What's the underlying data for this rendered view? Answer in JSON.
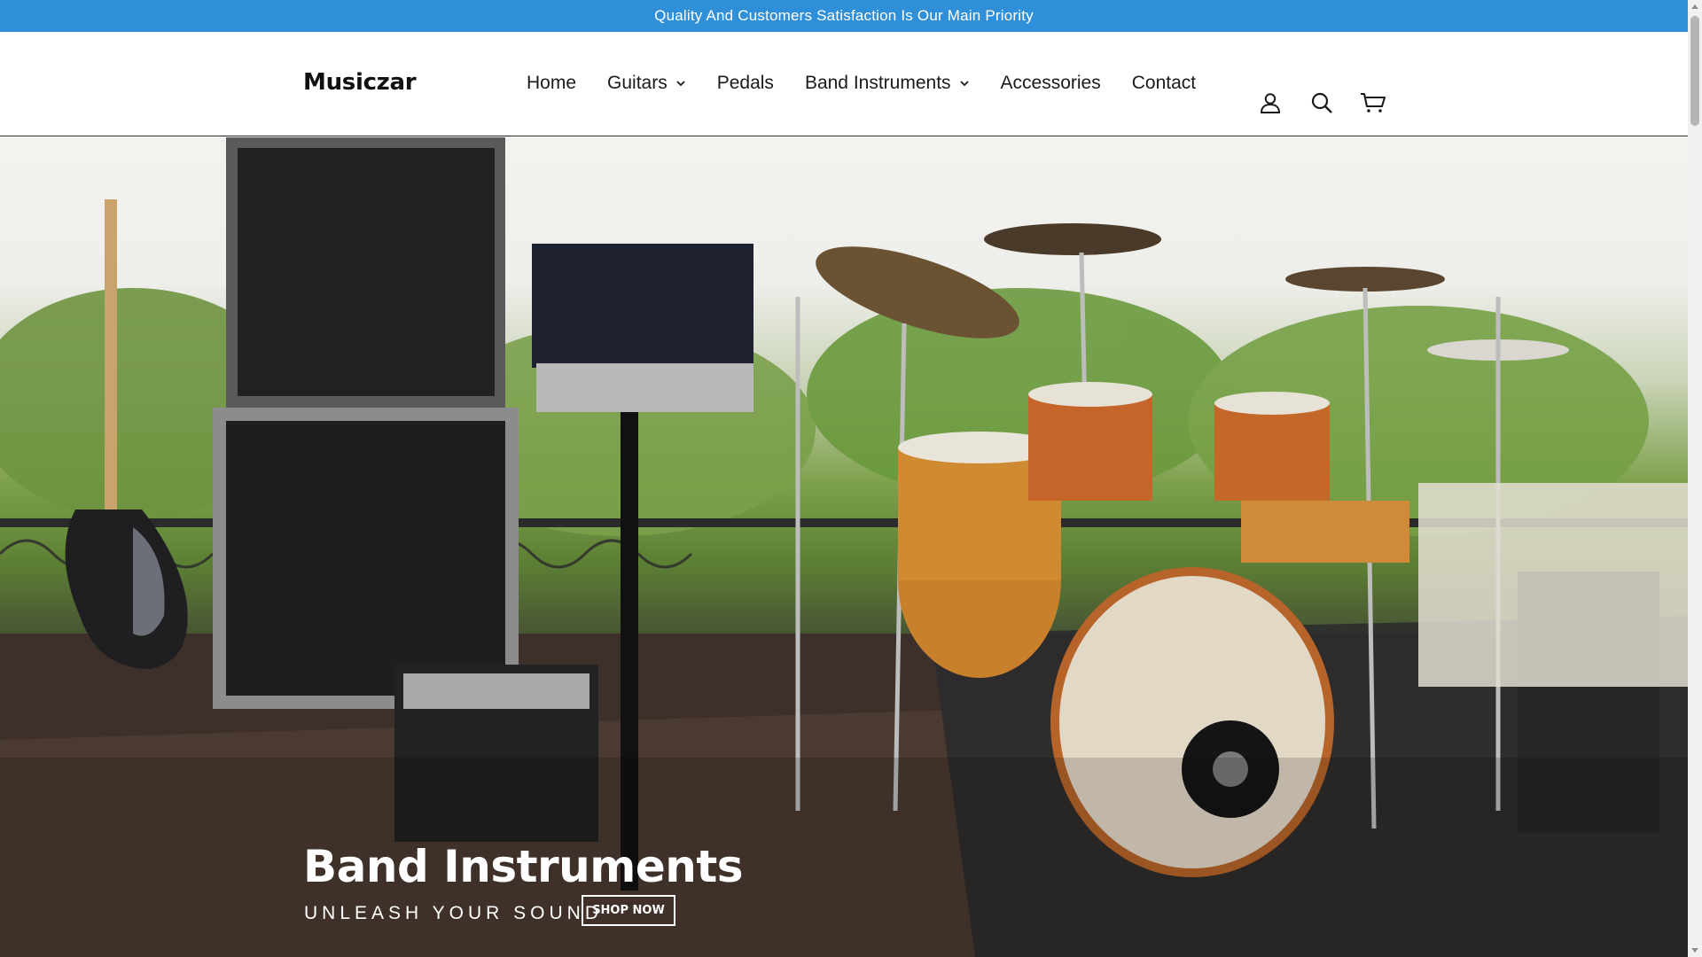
{
  "announcement": {
    "text": "Quality And Customers Satisfaction Is Our Main Priority",
    "background": "#2f8fd8"
  },
  "header": {
    "logo": "Musiczar",
    "nav": [
      {
        "label": "Home",
        "has_dropdown": false
      },
      {
        "label": "Guitars",
        "has_dropdown": true
      },
      {
        "label": "Pedals",
        "has_dropdown": false
      },
      {
        "label": "Band Instruments",
        "has_dropdown": true
      },
      {
        "label": "Accessories",
        "has_dropdown": false
      },
      {
        "label": "Contact",
        "has_dropdown": false
      }
    ],
    "icons": [
      "account-icon",
      "search-icon",
      "cart-icon"
    ]
  },
  "hero": {
    "title": "Band Instruments",
    "subtitle": "UNLEASH YOUR SOUND",
    "button_label": "SHOP NOW",
    "image_subject": "drum-kit-stage-photo"
  }
}
